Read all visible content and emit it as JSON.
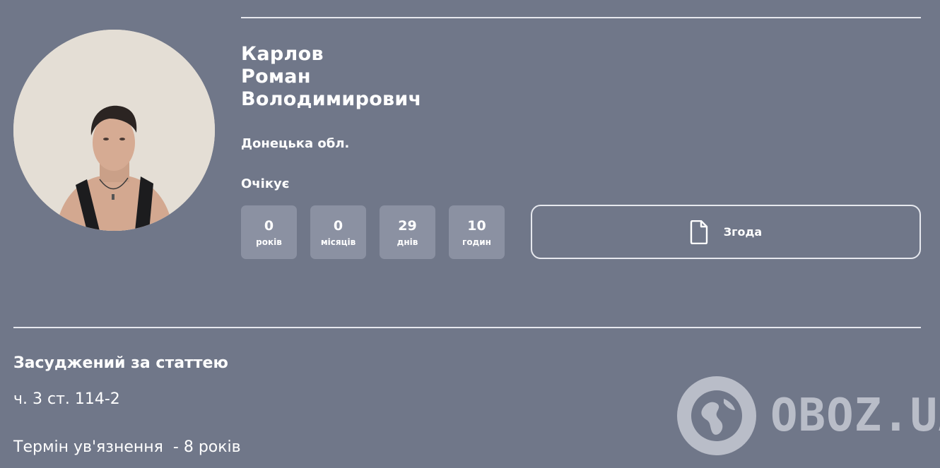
{
  "person": {
    "surname": "Карлов",
    "first_name": "Роман",
    "patronymic": "Володимирович",
    "region": "Донецька обл."
  },
  "status": "Очікує",
  "counters": [
    {
      "value": "0",
      "unit": "років"
    },
    {
      "value": "0",
      "unit": "місяців"
    },
    {
      "value": "29",
      "unit": "днів"
    },
    {
      "value": "10",
      "unit": "годин"
    }
  ],
  "consent_button": {
    "label": "Згода",
    "icon": "document-icon"
  },
  "sentence": {
    "title": "Засуджений за статтею",
    "article": "ч. 3 ст. 114-2",
    "term": "Термін ув'язнення  - 8 років"
  },
  "watermark": {
    "text": "OBOZ.UA",
    "icon": "globe-icon"
  },
  "colors": {
    "background": "#707789",
    "counter_bg": "#8b91a2",
    "divider": "#e6e8ee",
    "watermark": "#b9bdc8"
  }
}
